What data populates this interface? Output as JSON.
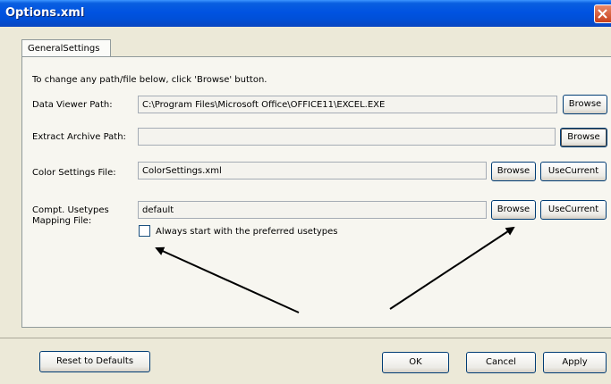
{
  "window": {
    "title": "Options.xml",
    "close_icon": "close-icon"
  },
  "tabs": [
    {
      "label": "GeneralSettings"
    }
  ],
  "panel": {
    "instruction": "To change any path/file below, click 'Browse' button.",
    "rows": {
      "data_viewer": {
        "label": "Data Viewer Path:",
        "value": "C:\\Program Files\\Microsoft Office\\OFFICE11\\EXCEL.EXE",
        "browse": "Browse"
      },
      "extract_archive": {
        "label": "Extract Archive Path:",
        "value": "",
        "browse": "Browse"
      },
      "color_settings": {
        "label": "Color Settings File:",
        "value": "ColorSettings.xml",
        "browse": "Browse",
        "use_current": "UseCurrent"
      },
      "usetypes": {
        "label_line1": "Compt. Usetypes",
        "label_line2": "Mapping File:",
        "value": "default",
        "browse": "Browse",
        "use_current": "UseCurrent"
      }
    },
    "checkbox": {
      "label": "Always start with the preferred usetypes",
      "checked": false
    }
  },
  "footer": {
    "reset": "Reset to Defaults",
    "ok": "OK",
    "cancel": "Cancel",
    "apply": "Apply"
  },
  "colors": {
    "title_bar": "#0053e1",
    "dialog_bg": "#ece9d8",
    "annotation_arrow": "#000000"
  }
}
